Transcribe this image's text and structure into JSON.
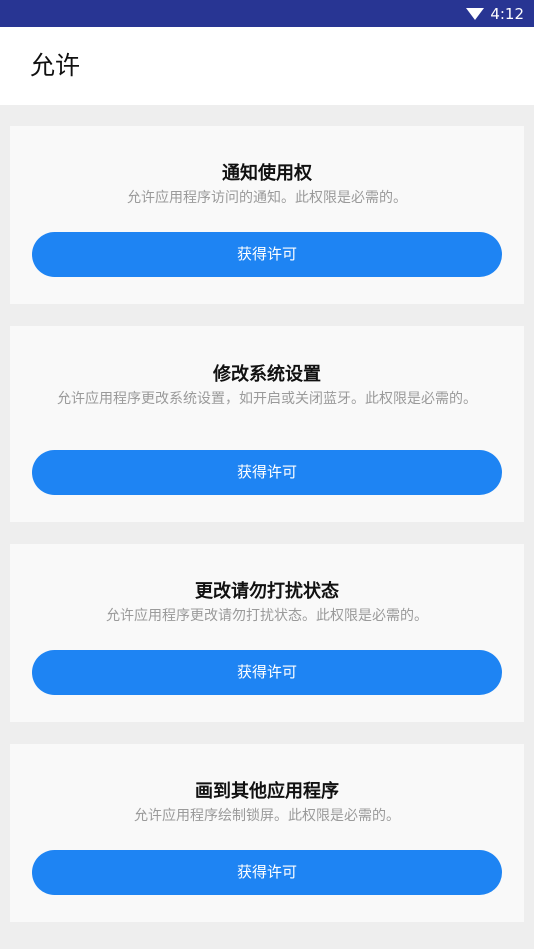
{
  "status_bar": {
    "time": "4:12",
    "icons": [
      "wifi-icon"
    ]
  },
  "header": {
    "title": "允许"
  },
  "permissions": [
    {
      "title": "通知使用权",
      "description": "允许应用程序访问的通知。此权限是必需的。",
      "button_label": "获得许可"
    },
    {
      "title": "修改系统设置",
      "description": "允许应用程序更改系统设置，如开启或关闭蓝牙。此权限是必需的。",
      "button_label": "获得许可"
    },
    {
      "title": "更改请勿打扰状态",
      "description": "允许应用程序更改请勿打扰状态。此权限是必需的。",
      "button_label": "获得许可"
    },
    {
      "title": "画到其他应用程序",
      "description": "允许应用程序绘制锁屏。此权限是必需的。",
      "button_label": "获得许可"
    }
  ],
  "colors": {
    "status_bar": "#283593",
    "accent": "#1e84f3",
    "background": "#eeeeee",
    "card": "#f9f9f9"
  }
}
